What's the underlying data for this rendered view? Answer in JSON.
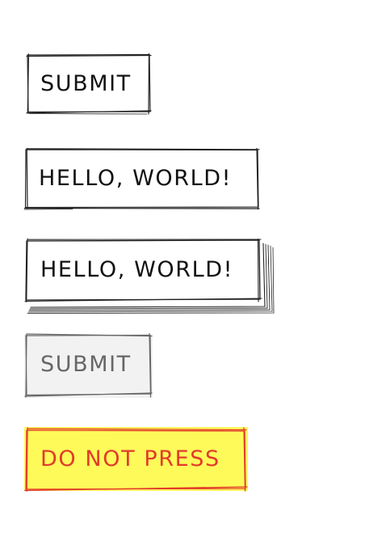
{
  "buttons": [
    {
      "label": "SUBMIT",
      "state": "default"
    },
    {
      "label": "HELLO, WORLD!",
      "state": "default"
    },
    {
      "label": "HELLO, WORLD!",
      "state": "raised"
    },
    {
      "label": "SUBMIT",
      "state": "disabled"
    },
    {
      "label": "DO NOT PRESS",
      "state": "warning"
    }
  ],
  "colors": {
    "ink": "#111111",
    "disabled_text": "#666666",
    "disabled_fill": "#f2f2f2",
    "warning_fill": "#fdfa5a",
    "warning_text": "#e23a2a"
  }
}
